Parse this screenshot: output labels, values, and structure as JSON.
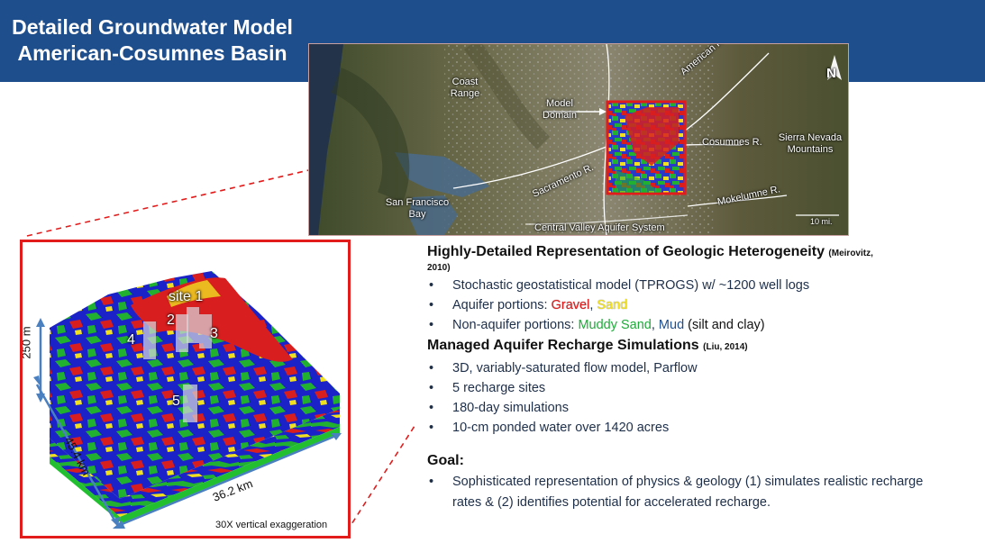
{
  "title": {
    "line1": "Detailed Groundwater Model",
    "line2": "American-Cosumnes Basin"
  },
  "map": {
    "labels": {
      "coast_range": "Coast Range",
      "model_domain": "Model Domain",
      "american_r": "American R.",
      "north": "N",
      "cosumnes_r": "Cosumnes R.",
      "sierra_nevada": "Sierra Nevada Mountains",
      "sacramento_r": "Sacramento R.",
      "san_francisco_bay": "San Francisco Bay",
      "mokelumne_r": "Mokelumne R.",
      "central_valley": "Central Valley Aquifer System",
      "scale": "10 mi."
    }
  },
  "model": {
    "sites": {
      "site1": "site 1",
      "site2": "2",
      "site3": "3",
      "site4": "4",
      "site5": "5"
    },
    "dims": {
      "depth": "250 m",
      "length": "45.4 km",
      "width": "36.2 km"
    },
    "exaggeration": "30X vertical exaggeration",
    "colors": {
      "gravel": "#d81e1e",
      "sand": "#f0e020",
      "muddy_sand": "#22b030",
      "mud": "#1a22c8"
    }
  },
  "section1": {
    "heading": "Highly-Detailed Representation of Geologic Heterogeneity",
    "cite_a": "(Meirovitz,",
    "cite_b": "2010)",
    "bullet1": "Stochastic geostatistical model (TPROGS) w/  ~1200 well logs",
    "bullet2_prefix": "Aquifer portions: ",
    "bullet2_gravel": "Gravel",
    "bullet2_comma": ", ",
    "bullet2_sand": "Sand",
    "bullet3_prefix": "Non-aquifer portions:  ",
    "bullet3_muddy": "Muddy Sand",
    "bullet3_comma": ", ",
    "bullet3_mud": "Mud",
    "bullet3_suffix": " (silt and clay)"
  },
  "section2": {
    "heading": "Managed Aquifer Recharge Simulations",
    "cite": "(Liu, 2014)",
    "bullets": [
      "3D, variably-saturated flow model, Parflow",
      "5 recharge sites",
      "180-day simulations",
      "10-cm ponded water over 1420 acres"
    ]
  },
  "goal": {
    "heading": "Goal:",
    "bullet": "Sophisticated representation of physics & geology (1) simulates realistic recharge rates & (2) identifies potential for accelerated recharge."
  }
}
